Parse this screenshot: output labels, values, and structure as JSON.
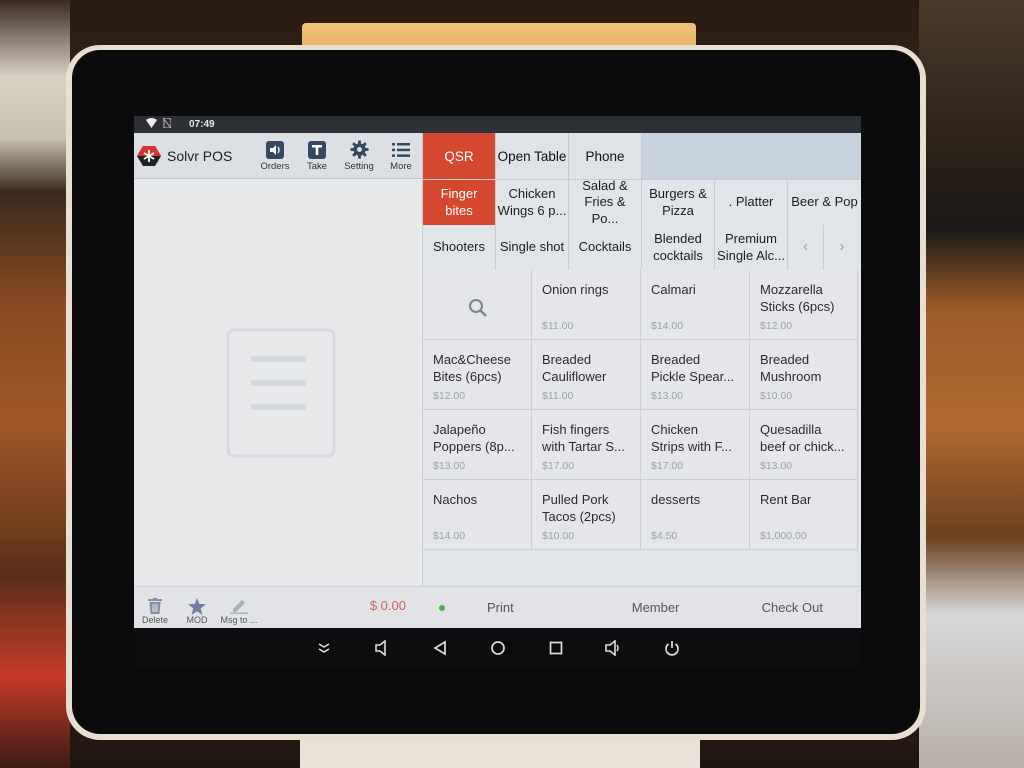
{
  "status_bar": {
    "time": "07:49",
    "icons": [
      "wifi-icon",
      "no-sim-icon"
    ]
  },
  "header": {
    "app_title": "Solvr POS",
    "buttons": [
      {
        "label": "Orders",
        "icon": "speaker-icon"
      },
      {
        "label": "Take",
        "icon": "take-t-icon"
      },
      {
        "label": "Setting",
        "icon": "gear-icon"
      },
      {
        "label": "More",
        "icon": "list-icon"
      }
    ]
  },
  "order_panel": {
    "empty_icon": "empty-order-icon",
    "footer": {
      "delete_label": "Delete",
      "mod_label": "MOD",
      "msg_label": "Msg to ...",
      "total": "$ 0.00"
    }
  },
  "tabs": [
    {
      "label": "QSR",
      "active": true
    },
    {
      "label": "Open Table",
      "active": false
    },
    {
      "label": "Phone",
      "active": false
    }
  ],
  "categories_row1": [
    {
      "label": "Finger\nbites",
      "active": true
    },
    {
      "label": "Chicken\nWings 6 p..."
    },
    {
      "label": "Salad &\nFries & Po..."
    },
    {
      "label": "Burgers &\nPizza"
    },
    {
      "label": ". Platter"
    },
    {
      "label": "Beer & Pop"
    }
  ],
  "categories_row2": [
    {
      "label": "Shooters"
    },
    {
      "label": "Single shot"
    },
    {
      "label": "Cocktails"
    },
    {
      "label": "Blended\ncocktails"
    },
    {
      "label": "Premium\nSingle Alc..."
    }
  ],
  "pager": {
    "prev": "‹",
    "next": "›"
  },
  "items": [
    {
      "name": "Onion rings",
      "price": "$11.00"
    },
    {
      "name": "Calmari",
      "price": "$14.00"
    },
    {
      "name": "Mozzarella\nSticks (6pcs)",
      "price": "$12.00"
    },
    {
      "name": "Mac&Cheese\nBites (6pcs)",
      "price": "$12.00"
    },
    {
      "name": "Breaded\nCauliflower",
      "price": "$11.00"
    },
    {
      "name": "Breaded\nPickle Spear...",
      "price": "$13.00"
    },
    {
      "name": "Breaded\nMushroom",
      "price": "$10.00"
    },
    {
      "name": "Jalapeño\nPoppers (8p...",
      "price": "$13.00"
    },
    {
      "name": "Fish fingers\nwith Tartar S...",
      "price": "$17.00"
    },
    {
      "name": "Chicken\nStrips with F...",
      "price": "$17.00"
    },
    {
      "name": "Quesadilla\nbeef or chick...",
      "price": "$13.00"
    },
    {
      "name": "Nachos",
      "price": "$14.00"
    },
    {
      "name": "Pulled Pork\nTacos (2pcs)",
      "price": "$10.00"
    },
    {
      "name": "desserts",
      "price": "$4.50"
    },
    {
      "name": "Rent Bar",
      "price": "$1,000.00"
    }
  ],
  "action_bar": {
    "status_color": "#4caf50",
    "print_label": "Print",
    "member_label": "Member",
    "checkout_label": "Check Out"
  },
  "accent_color": "#d4482f",
  "system_nav": [
    "collapse-icon",
    "volume-down-icon",
    "back-icon",
    "home-icon",
    "recents-icon",
    "volume-up-icon",
    "power-icon"
  ]
}
